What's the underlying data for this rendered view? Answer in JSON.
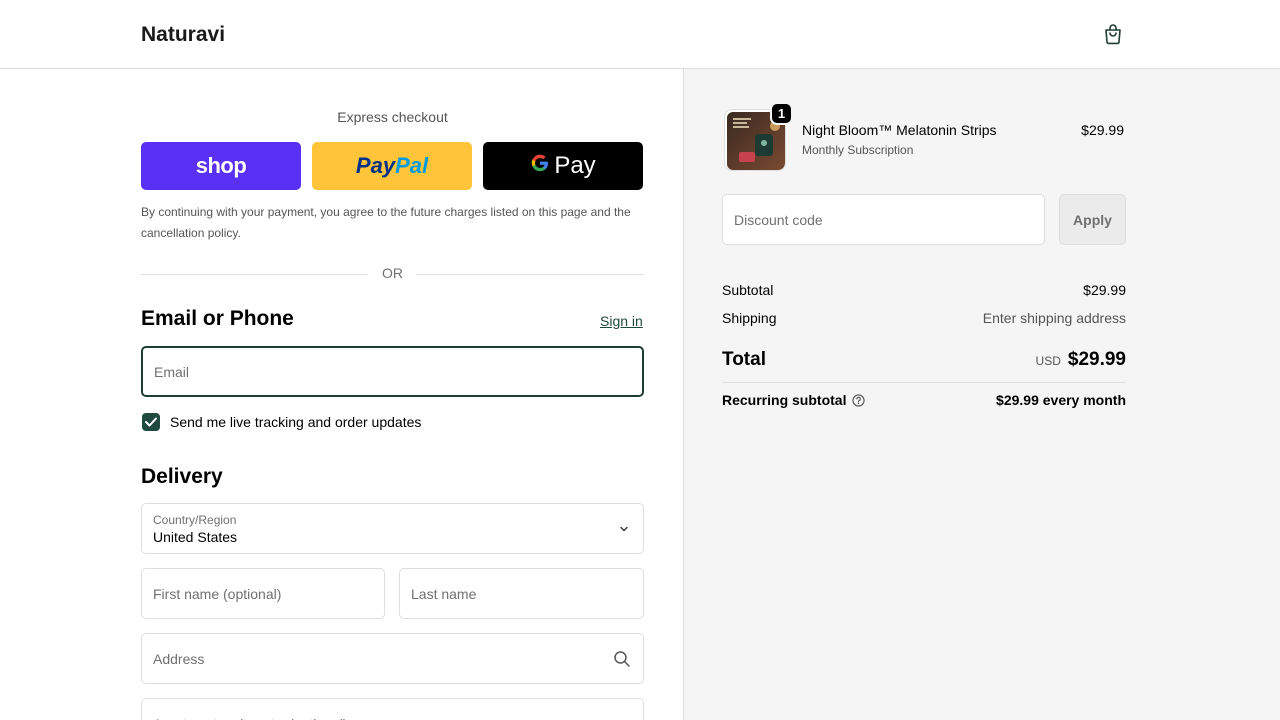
{
  "header": {
    "brand": "Naturavi",
    "cart_icon": "shopping-bag-icon"
  },
  "express": {
    "label": "Express checkout",
    "shop_label": "shop",
    "paypal_part1": "Pay",
    "paypal_part2": "Pal",
    "gpay_g": "G",
    "gpay_label": "Pay",
    "terms": "By continuing with your payment, you agree to the future charges listed on this page and the cancellation policy.",
    "or": "OR"
  },
  "contact": {
    "title": "Email or Phone",
    "signin": "Sign in",
    "email_placeholder": "Email",
    "email_value": "",
    "updates_label": "Send me live tracking and order updates",
    "updates_checked": true
  },
  "delivery": {
    "title": "Delivery",
    "country_label": "Country/Region",
    "country_value": "United States",
    "first_name_placeholder": "First name (optional)",
    "last_name_placeholder": "Last name",
    "address_placeholder": "Address",
    "apartment_placeholder": "Apartment, suite, etc. (optional)"
  },
  "summary": {
    "item": {
      "quantity": "1",
      "name": "Night Bloom™ Melatonin Strips",
      "subtitle": "Monthly Subscription",
      "price": "$29.99"
    },
    "discount_placeholder": "Discount code",
    "apply_label": "Apply",
    "subtotal_label": "Subtotal",
    "subtotal_value": "$29.99",
    "shipping_label": "Shipping",
    "shipping_value": "Enter shipping address",
    "total_label": "Total",
    "currency": "USD",
    "total_value": "$29.99",
    "recurring_label": "Recurring subtotal",
    "recurring_value": "$29.99 every month"
  },
  "colors": {
    "shop_pay": "#5a31f4",
    "paypal": "#ffc439",
    "gpay": "#000000",
    "accent": "#1f4a3d",
    "summary_bg": "#f5f5f5"
  }
}
